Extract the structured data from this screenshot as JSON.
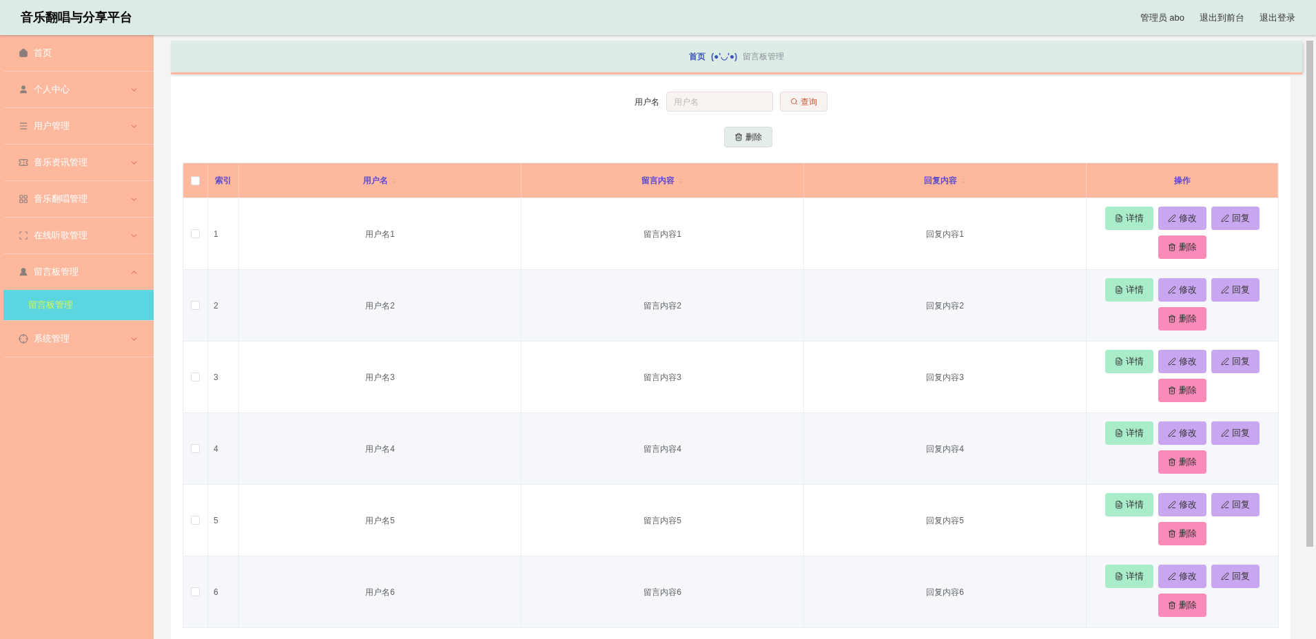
{
  "header": {
    "title": "音乐翻唱与分享平台",
    "links": [
      "管理员 abo",
      "退出到前台",
      "退出登录"
    ]
  },
  "sidebar": {
    "items": [
      {
        "label": "首页"
      },
      {
        "label": "个人中心",
        "expanded": false
      },
      {
        "label": "用户管理",
        "expanded": false
      },
      {
        "label": "音乐资讯管理",
        "expanded": false
      },
      {
        "label": "音乐翻唱管理",
        "expanded": false
      },
      {
        "label": "在线听歌管理",
        "expanded": false
      },
      {
        "label": "留言板管理",
        "expanded": true,
        "children": [
          {
            "label": "留言板管理",
            "selected": true
          }
        ]
      },
      {
        "label": "系统管理",
        "expanded": false
      }
    ]
  },
  "breadcrumb": {
    "home": "首页",
    "separator": "(●'◡'●)",
    "current": "留言板管理"
  },
  "search": {
    "label": "用户名",
    "placeholder": "用户名",
    "button": "查询"
  },
  "bulk_delete": "删除",
  "table": {
    "select_all": false,
    "columns": [
      {
        "label": "索引"
      },
      {
        "label": "用户名",
        "sortable": true
      },
      {
        "label": "留言内容",
        "sortable": true
      },
      {
        "label": "回复内容",
        "sortable": true
      },
      {
        "label": "操作"
      }
    ],
    "rows": [
      {
        "checked": false,
        "index": "1",
        "username": "用户名1",
        "message": "留言内容1",
        "reply": "回复内容1",
        "actions": [
          {
            "kind": "detail",
            "label": "详情"
          },
          {
            "kind": "edit",
            "label": "修改"
          },
          {
            "kind": "reply",
            "label": "回复"
          },
          {
            "kind": "delete",
            "label": "删除"
          }
        ]
      },
      {
        "checked": false,
        "index": "2",
        "username": "用户名2",
        "message": "留言内容2",
        "reply": "回复内容2",
        "actions": [
          {
            "kind": "detail",
            "label": "详情"
          },
          {
            "kind": "edit",
            "label": "修改"
          },
          {
            "kind": "reply",
            "label": "回复"
          },
          {
            "kind": "delete",
            "label": "删除"
          }
        ]
      },
      {
        "checked": false,
        "index": "3",
        "username": "用户名3",
        "message": "留言内容3",
        "reply": "回复内容3",
        "actions": [
          {
            "kind": "detail",
            "label": "详情"
          },
          {
            "kind": "edit",
            "label": "修改"
          },
          {
            "kind": "reply",
            "label": "回复"
          },
          {
            "kind": "delete",
            "label": "删除"
          }
        ]
      },
      {
        "checked": false,
        "index": "4",
        "username": "用户名4",
        "message": "留言内容4",
        "reply": "回复内容4",
        "actions": [
          {
            "kind": "detail",
            "label": "详情"
          },
          {
            "kind": "edit",
            "label": "修改"
          },
          {
            "kind": "reply",
            "label": "回复"
          },
          {
            "kind": "delete",
            "label": "删除"
          }
        ]
      },
      {
        "checked": false,
        "index": "5",
        "username": "用户名5",
        "message": "留言内容5",
        "reply": "回复内容5",
        "actions": [
          {
            "kind": "detail",
            "label": "详情"
          },
          {
            "kind": "edit",
            "label": "修改"
          },
          {
            "kind": "reply",
            "label": "回复"
          },
          {
            "kind": "delete",
            "label": "删除"
          }
        ]
      },
      {
        "checked": false,
        "index": "6",
        "username": "用户名6",
        "message": "留言内容6",
        "reply": "回复内容6",
        "actions": [
          {
            "kind": "detail",
            "label": "详情"
          },
          {
            "kind": "edit",
            "label": "修改"
          },
          {
            "kind": "reply",
            "label": "回复"
          },
          {
            "kind": "delete",
            "label": "删除"
          }
        ]
      }
    ]
  }
}
